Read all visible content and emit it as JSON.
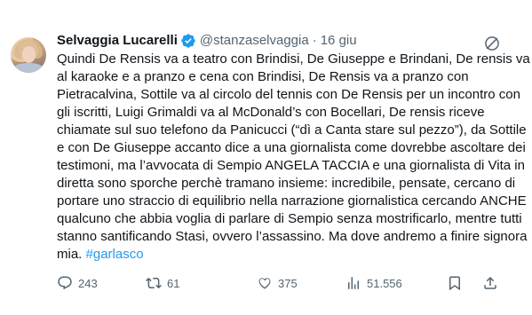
{
  "author": {
    "name": "Selvaggia Lucarelli",
    "handle": "@stanzaselvaggia",
    "separator": "·",
    "time": "16 giu"
  },
  "tweet": {
    "text": "Quindi De Rensis va a teatro con Brindisi, De Giuseppe e Brindani, De rensis va al karaoke e a pranzo e cena con Brindisi, De Rensis va a pranzo con Pietracalvina, Sottile va al circolo del tennis con De Rensis per un incontro con gli iscritti, Luigi Grimaldi va al McDonald’s con Bocellari, De rensis riceve chiamate sul suo telefono da Panicucci (“dì a Canta stare sul pezzo”), da Sottile e con De Giuseppe accanto dice a una giornalista come dovrebbe ascoltare dei testimoni, ma l’avvocata di Sempio ANGELA TACCIA e una giornalista di Vita in diretta sono sporche perchè tramano insieme: incredibile, pensate, cercano di portare uno straccio di equilibrio nella narrazione giornalistica cercando ANCHE qualcuno che abbia voglia di parlare di Sempio senza mostrificarlo, mentre tutti stanno santificando Stasi, ovvero l’assassino. Ma dove andremo a finire signora mia. ",
    "hashtag": "#garlasco"
  },
  "actions": {
    "replies": "243",
    "retweets": "61",
    "likes": "375",
    "views": "51.556"
  },
  "colors": {
    "accent": "#1d9bf0",
    "text": "#0f1419",
    "muted": "#536471"
  },
  "icons": [
    "verified-badge-icon",
    "grok-icon",
    "reply-icon",
    "retweet-icon",
    "like-icon",
    "views-icon",
    "bookmark-icon",
    "share-icon"
  ]
}
